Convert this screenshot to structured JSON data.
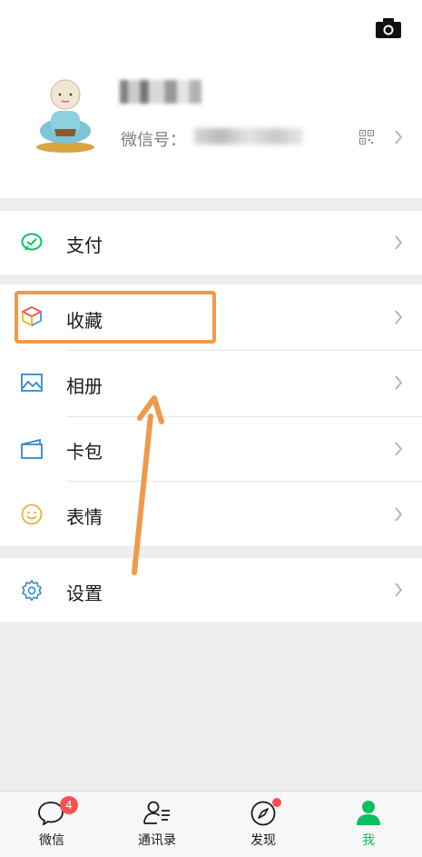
{
  "profile": {
    "wxid_label": "微信号："
  },
  "menu": {
    "pay": "支付",
    "favorites": "收藏",
    "album": "相册",
    "cards": "卡包",
    "stickers": "表情",
    "settings": "设置"
  },
  "tabbar": {
    "chats": "微信",
    "chats_badge": "4",
    "contacts": "通讯录",
    "discover": "发现",
    "me": "我"
  },
  "colors": {
    "accent": "#07c160",
    "highlight": "#ef9a4b",
    "badge": "#fa5151"
  }
}
